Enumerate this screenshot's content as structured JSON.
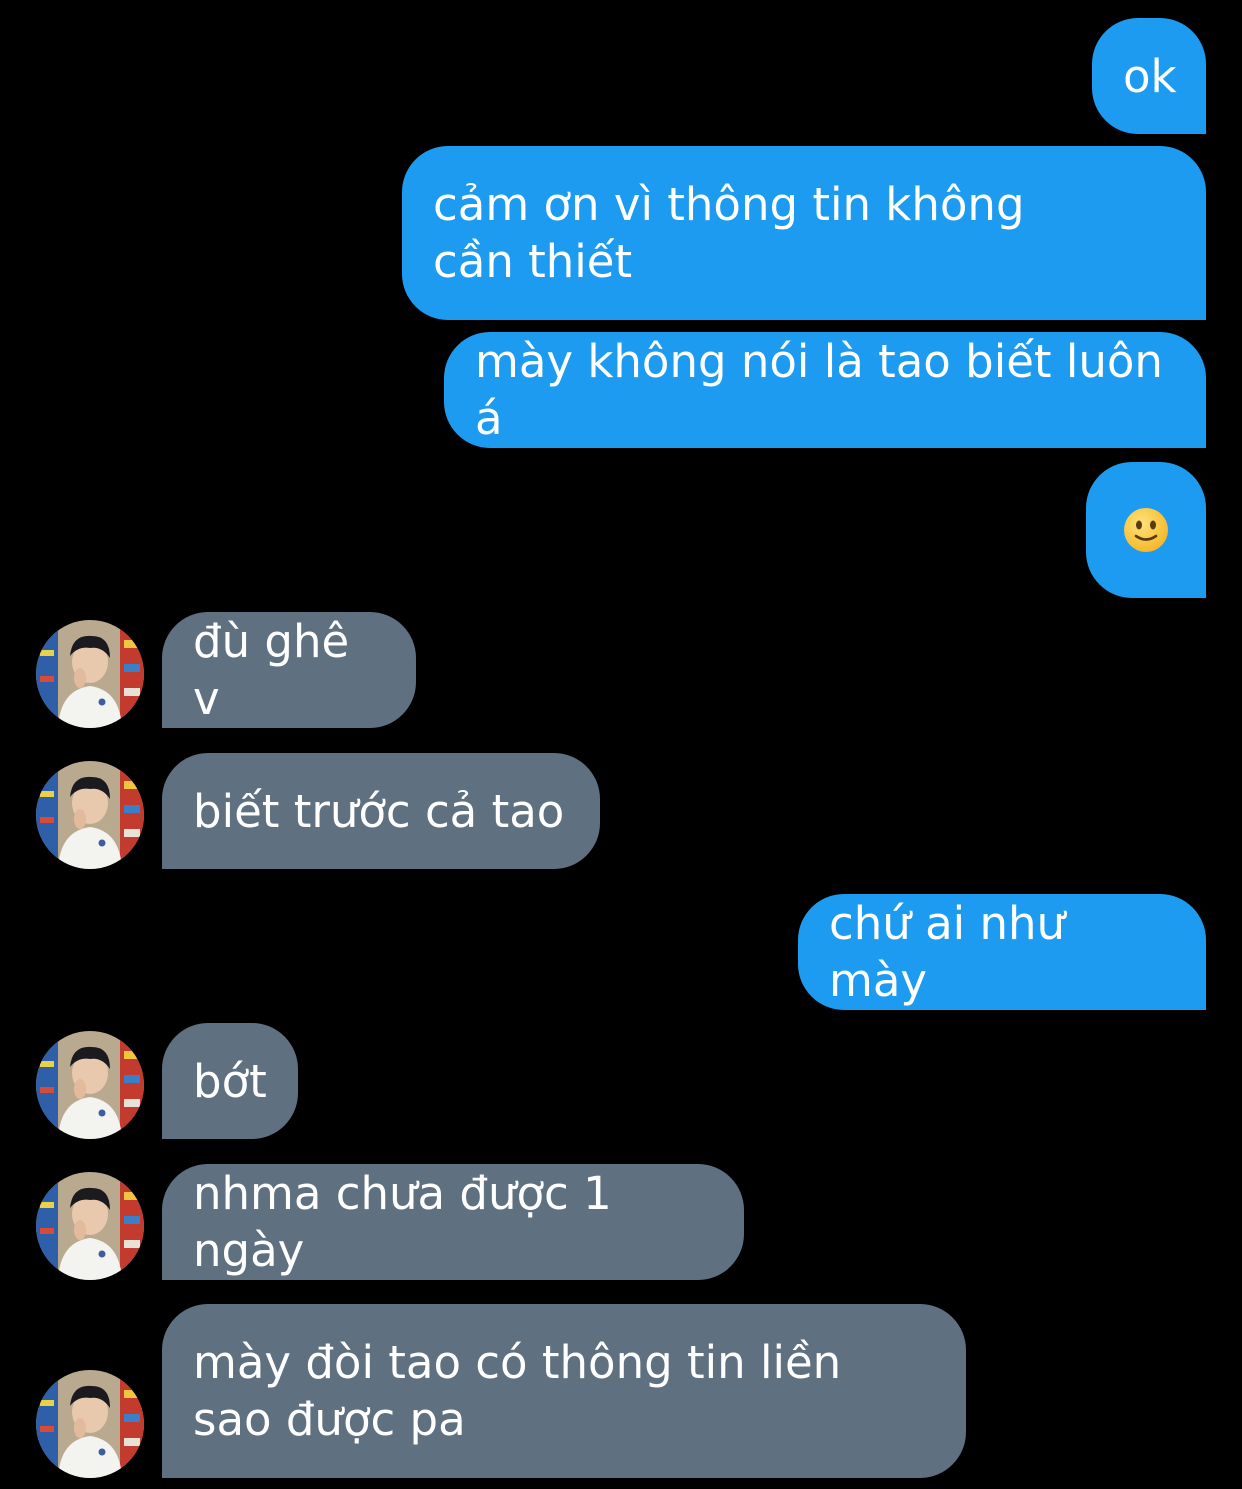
{
  "colors": {
    "background": "#000000",
    "outgoing_bubble": "#1d9bf0",
    "incoming_bubble": "#5f7080",
    "text": "#ffffff"
  },
  "messages": [
    {
      "direction": "outgoing",
      "text": "ok"
    },
    {
      "direction": "outgoing",
      "text": "cảm ơn vì thông tin không cần thiết"
    },
    {
      "direction": "outgoing",
      "text": "mày không nói là tao biết luôn á"
    },
    {
      "direction": "outgoing",
      "text": "🙂",
      "icon": "slightly-smiling-face-emoji"
    },
    {
      "direction": "incoming",
      "text": "đù ghê v",
      "avatar": "contact-avatar"
    },
    {
      "direction": "incoming",
      "text": "biết trước cả tao",
      "avatar": "contact-avatar"
    },
    {
      "direction": "outgoing",
      "text": "chứ ai như mày"
    },
    {
      "direction": "incoming",
      "text": "bớt",
      "avatar": "contact-avatar"
    },
    {
      "direction": "incoming",
      "text": "nhma chưa được 1 ngày",
      "avatar": "contact-avatar"
    },
    {
      "direction": "incoming",
      "text": "mày đòi tao có thông tin liền sao được pa",
      "avatar": "contact-avatar"
    }
  ]
}
